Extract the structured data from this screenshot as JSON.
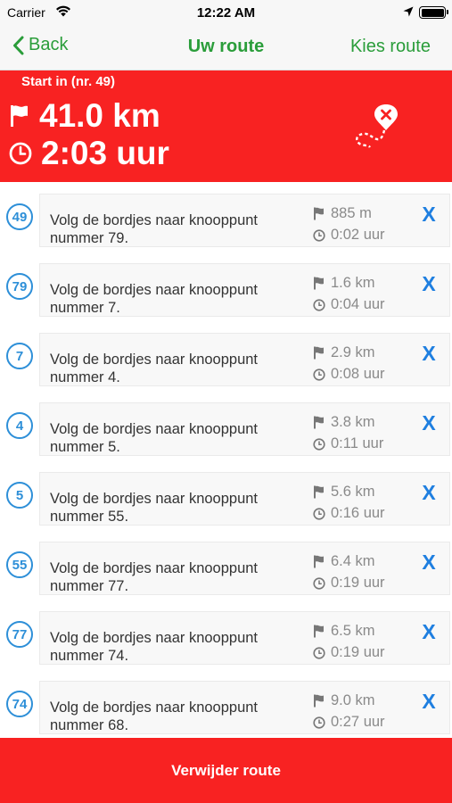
{
  "status_bar": {
    "carrier": "Carrier",
    "time": "12:22 AM"
  },
  "nav": {
    "back_label": "Back",
    "title": "Uw route",
    "right_label": "Kies route"
  },
  "summary": {
    "start_label": "Start in  (nr. 49)",
    "distance": "41.0 km",
    "duration": "2:03 uur"
  },
  "steps": [
    {
      "node": "49",
      "text": "Volg de bordjes naar knooppunt nummer 79.",
      "distance": "885 m",
      "time": "0:02 uur",
      "remove_label": "X"
    },
    {
      "node": "79",
      "text": "Volg de bordjes naar knooppunt nummer 7.",
      "distance": "1.6 km",
      "time": "0:04 uur",
      "remove_label": "X"
    },
    {
      "node": "7",
      "text": "Volg de bordjes naar knooppunt nummer 4.",
      "distance": "2.9 km",
      "time": "0:08 uur",
      "remove_label": "X"
    },
    {
      "node": "4",
      "text": "Volg de bordjes naar knooppunt nummer 5.",
      "distance": "3.8 km",
      "time": "0:11 uur",
      "remove_label": "X"
    },
    {
      "node": "5",
      "text": "Volg de bordjes naar knooppunt nummer 55.",
      "distance": "5.6 km",
      "time": "0:16 uur",
      "remove_label": "X"
    },
    {
      "node": "55",
      "text": "Volg de bordjes naar knooppunt nummer 77.",
      "distance": "6.4 km",
      "time": "0:19 uur",
      "remove_label": "X"
    },
    {
      "node": "77",
      "text": "Volg de bordjes naar knooppunt nummer 74.",
      "distance": "6.5 km",
      "time": "0:19 uur",
      "remove_label": "X"
    },
    {
      "node": "74",
      "text": "Volg de bordjes naar knooppunt nummer 68.",
      "distance": "9.0 km",
      "time": "0:27 uur",
      "remove_label": "X"
    }
  ],
  "footer": {
    "delete_label": "Verwijder route"
  },
  "colors": {
    "accent_green": "#2a9d3a",
    "header_red": "#f82222",
    "badge_blue": "#2d8fd8",
    "remove_blue": "#1f7fe0"
  },
  "icons": {
    "start": "flag-icon",
    "duration": "clock-icon",
    "route_map": "route-map-icon",
    "step_distance": "flag-icon",
    "step_time": "clock-icon"
  }
}
